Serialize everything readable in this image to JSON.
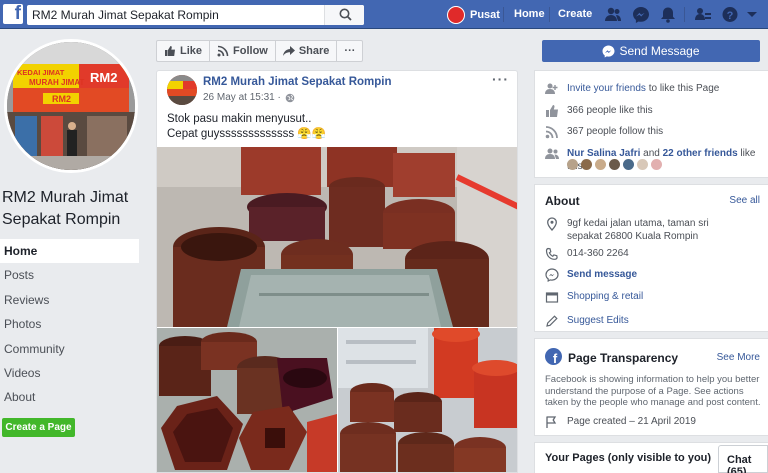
{
  "topbar": {
    "search_value": "RM2 Murah Jimat Sepakat Rompin",
    "profile_label": "Pusat",
    "home_label": "Home",
    "create_label": "Create"
  },
  "sidebar": {
    "page_name": "RM2 Murah Jimat Sepakat Rompin",
    "items": [
      {
        "label": "Home",
        "active": true
      },
      {
        "label": "Posts"
      },
      {
        "label": "Reviews"
      },
      {
        "label": "Photos"
      },
      {
        "label": "Community"
      },
      {
        "label": "Videos"
      },
      {
        "label": "About"
      }
    ],
    "create_page_label": "Create a Page"
  },
  "profile_sign": {
    "line1": "KEDAI JIMAT",
    "line2": "RM2",
    "line3": "MURAH JIMAT",
    "line4": "RM2"
  },
  "actions": {
    "like": "Like",
    "follow": "Follow",
    "share": "Share",
    "more": "···"
  },
  "post": {
    "author": "RM2 Murah Jimat Sepakat Rompin",
    "time": "26 May at 15:31 ·",
    "more": "···",
    "line1": "Stok pasu makin menyusut..",
    "line2": "Cepat guysssssssssssss 😤😤"
  },
  "right": {
    "send_message": "Send Message",
    "invite_link": "Invite your friends",
    "invite_rest": " to like this Page",
    "likes": "366 people like this",
    "follows": "367 people follow this",
    "friends_name": "Nur Salina Jafri",
    "friends_and": " and ",
    "friends_others": "22 other friends",
    "friends_rest": " like this",
    "about_title": "About",
    "about_see_all": "See all",
    "address": "9gf kedai jalan utama, taman sri sepakat 26800 Kuala Rompin",
    "phone": "014-360 2264",
    "send_message_link": "Send message",
    "category": "Shopping & retail",
    "suggest_edits": "Suggest Edits",
    "transparency_title": "Page Transparency",
    "transparency_see_more": "See More",
    "transparency_text": "Facebook is showing information to help you better understand the purpose of a Page. See actions taken by the people who manage and post content.",
    "page_created": "Page created – 21 April 2019",
    "your_pages": "Your Pages (only visible to you)",
    "chat": "Chat (65)"
  },
  "colors": {
    "fb_blue": "#4267b2",
    "link": "#365899",
    "green": "#42b72a",
    "background": "#e9ebee"
  }
}
